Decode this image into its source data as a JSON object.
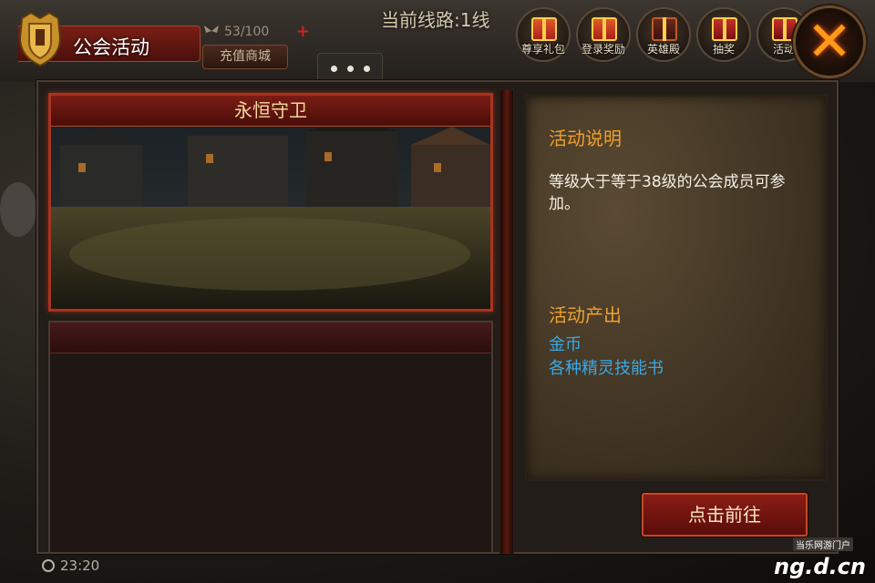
{
  "header": {
    "title": "公会活动",
    "energy": "53/100",
    "recharge_label": "充值商城",
    "line_info": "当前线路:1线"
  },
  "top_icons": [
    {
      "label": "尊享礼包"
    },
    {
      "label": "登录奖励"
    },
    {
      "label": "英雄殿"
    },
    {
      "label": "抽奖"
    },
    {
      "label": "活动"
    }
  ],
  "activity_list": [
    {
      "name": "永恒守卫",
      "selected": true
    }
  ],
  "detail": {
    "desc_title": "活动说明",
    "desc_body": "等级大于等于38级的公会成员可参加。",
    "output_title": "活动产出",
    "rewards": [
      "金币",
      "各种精灵技能书"
    ]
  },
  "go_label": "点击前往",
  "clock": "23:20",
  "watermark": {
    "small": "当乐网游门户",
    "big": "ng.d.cn"
  },
  "colors": {
    "accent": "#f0a02a",
    "reward": "#37a9e8",
    "button_red": "#8a1e16"
  }
}
